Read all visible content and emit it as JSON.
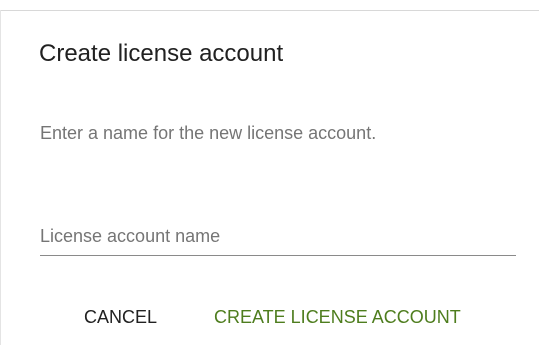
{
  "dialog": {
    "title": "Create license account",
    "description": "Enter a name for the new license account.",
    "name_field": {
      "placeholder": "License account name",
      "value": ""
    },
    "actions": {
      "cancel_label": "CANCEL",
      "create_label": "CREATE LICENSE ACCOUNT"
    }
  },
  "colors": {
    "primary_action": "#4e7d1e",
    "text_primary": "#212121",
    "text_secondary": "#757575",
    "underline": "#8a8a8a"
  }
}
